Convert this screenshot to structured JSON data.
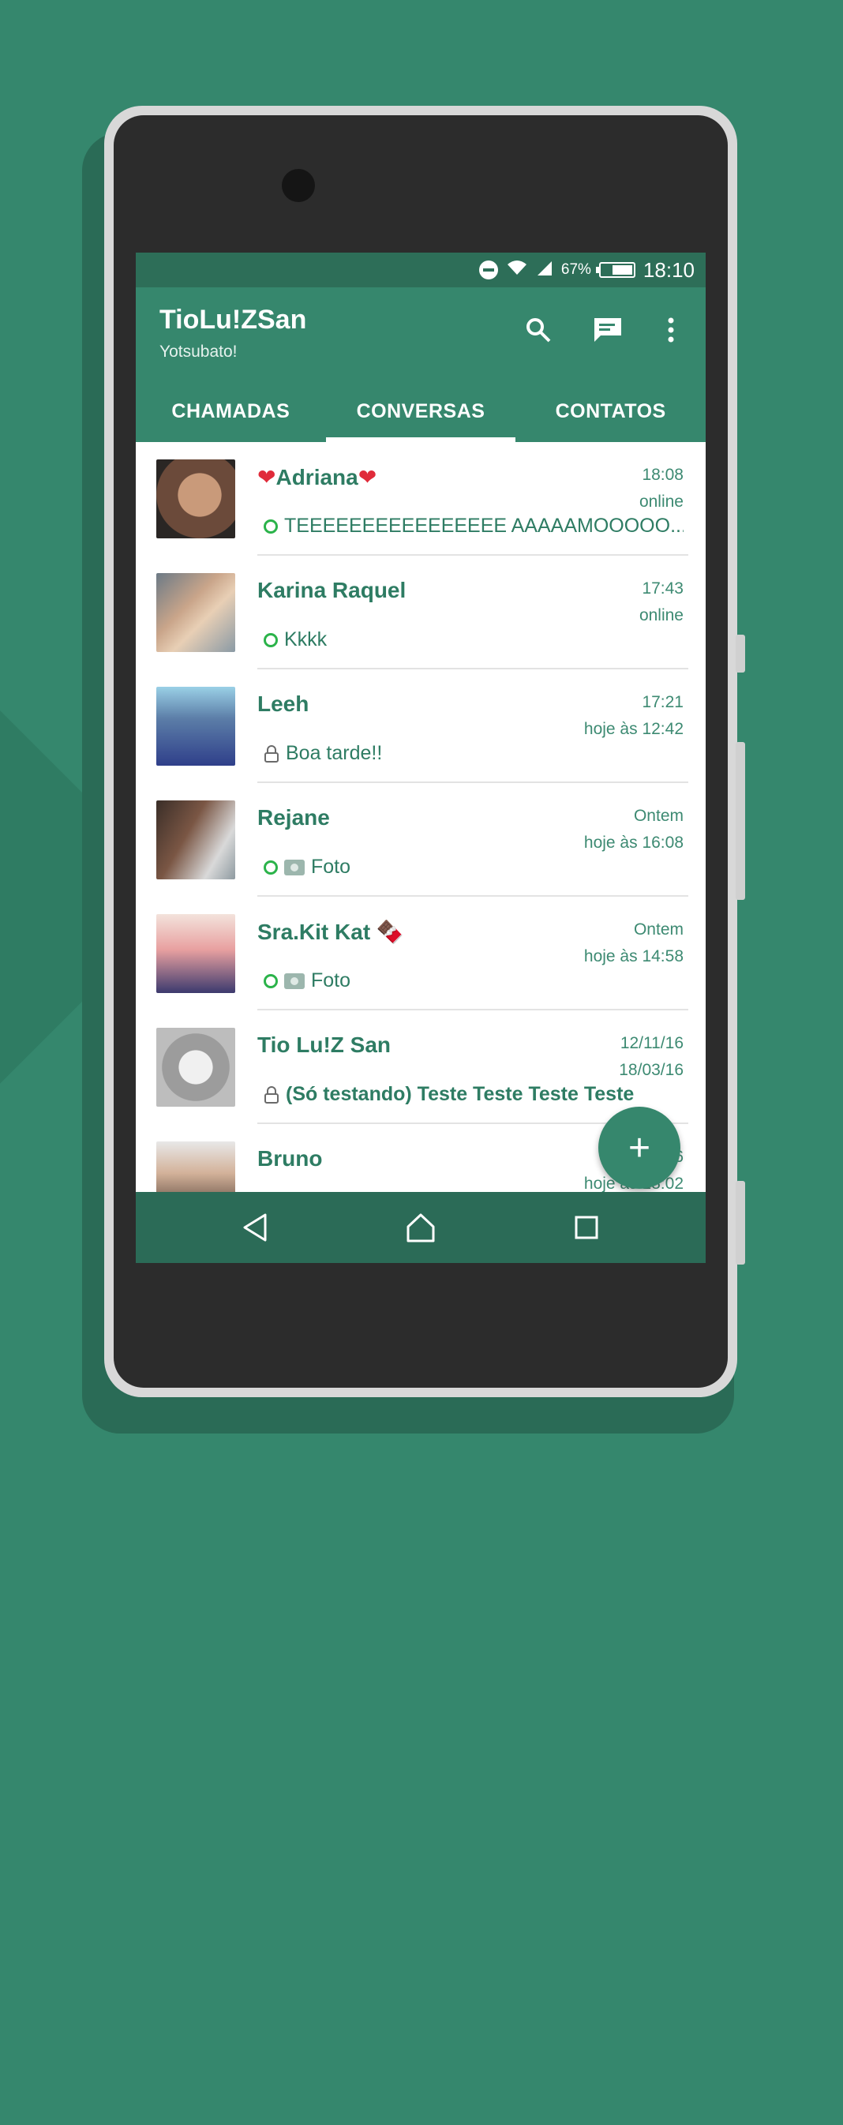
{
  "status_bar": {
    "battery_percent": "67%",
    "time": "18:10"
  },
  "appbar": {
    "title": "TioLu!ZSan",
    "subtitle": "Yotsubato!",
    "icons": [
      "search-icon",
      "chat-icon",
      "more-vert-icon"
    ]
  },
  "tabs": [
    {
      "label": "CHAMADAS",
      "active": false
    },
    {
      "label": "CONVERSAS",
      "active": true
    },
    {
      "label": "CONTATOS",
      "active": false
    }
  ],
  "chats": [
    {
      "name": "Adriana",
      "time": "18:08",
      "seen": "online",
      "status_icon": "online-ring-icon",
      "preview": "TEEEEEEEEEEEEEEEE AAAAAMOOOOO..."
    },
    {
      "name": "Karina Raquel",
      "time": "17:43",
      "seen": "online",
      "status_icon": "online-ring-icon",
      "preview": "Kkkk"
    },
    {
      "name": "Leeh",
      "time": "17:21",
      "seen": "hoje às 12:42",
      "status_icon": "lock-icon",
      "preview": "Boa tarde!!"
    },
    {
      "name": "Rejane",
      "time": "Ontem",
      "seen": "hoje às 16:08",
      "status_icon": "online-ring-icon",
      "preview": "Foto"
    },
    {
      "name": "Sra.Kit Kat 🍫",
      "time": "Ontem",
      "seen": "hoje às 14:58",
      "status_icon": "online-ring-icon",
      "preview": "Foto"
    },
    {
      "name": "Tio Lu!Z San",
      "time": "12/11/16",
      "seen": "18/03/16",
      "status_icon": "lock-icon",
      "preview": "(Só testando)  Teste Teste Teste Teste"
    },
    {
      "name": "Bruno",
      "time": "6",
      "seen": "hoje às 18:02",
      "status_icon": "",
      "preview": ""
    }
  ],
  "fab": {
    "label": "+"
  },
  "colors": {
    "primary": "#36876d",
    "status_bar": "#2d6e58",
    "online": "#2bb34a",
    "background": "#35876d"
  }
}
